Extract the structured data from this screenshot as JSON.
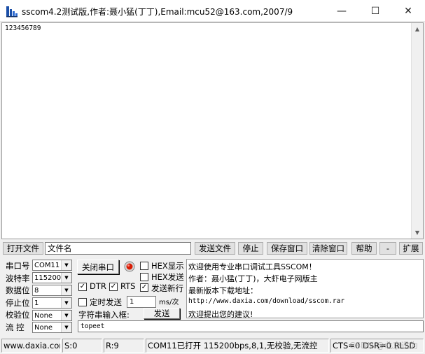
{
  "window": {
    "title": "sscom4.2测试版,作者:聂小猛(丁丁),Email:mcu52@163.com,2007/9",
    "minimize_glyph": "—",
    "maximize_glyph": "☐",
    "close_glyph": "✕"
  },
  "receive": {
    "text": "123456789"
  },
  "file_row": {
    "open_file_label": "打开文件",
    "file_name_value": "文件名",
    "send_file_label": "发送文件",
    "stop_label": "停止",
    "save_window_label": "保存窗口",
    "clear_window_label": "清除窗口",
    "help_label": "帮助",
    "collapse_label": "-",
    "expand_label": "扩展"
  },
  "settings": {
    "port_label": "串口号",
    "port_value": "COM11",
    "baud_label": "波特率",
    "baud_value": "115200",
    "databits_label": "数据位",
    "databits_value": "8",
    "stopbits_label": "停止位",
    "stopbits_value": "1",
    "parity_label": "校验位",
    "parity_value": "None",
    "flow_label": "流 控",
    "flow_value": "None"
  },
  "controls": {
    "close_port_label": "关闭串口",
    "hex_display_label": "HEX显示",
    "hex_send_label": "HEX发送",
    "dtr_label": "DTR",
    "rts_label": "RTS",
    "send_newline_label": "发送新行",
    "timed_send_label": "定时发送",
    "timed_value": "1",
    "interval_unit": "ms/次",
    "string_input_label": "字符串输入框:",
    "send_label": "发送",
    "send_text": "topeet"
  },
  "info": {
    "line1": "欢迎使用专业串口调试工具SSCOM！",
    "line2": "作者：聂小猛(丁丁)，大虾电子网版主",
    "line3": "最新版本下载地址：",
    "line4": "http://www.daxia.com/download/sscom.rar",
    "line5": "欢迎提出您的建议!"
  },
  "status": {
    "website": "www.daxia.cor",
    "sent": "S:0",
    "received": "R:9",
    "port_state": "COM11已打开  115200bps,8,1,无校验,无流控",
    "signals": "CTS=0 DSR=0 RLSD"
  },
  "watermark": "CSDN @北京迅为",
  "colors": {
    "led_red": "#d81e06",
    "accent": "#1b4fa8"
  }
}
